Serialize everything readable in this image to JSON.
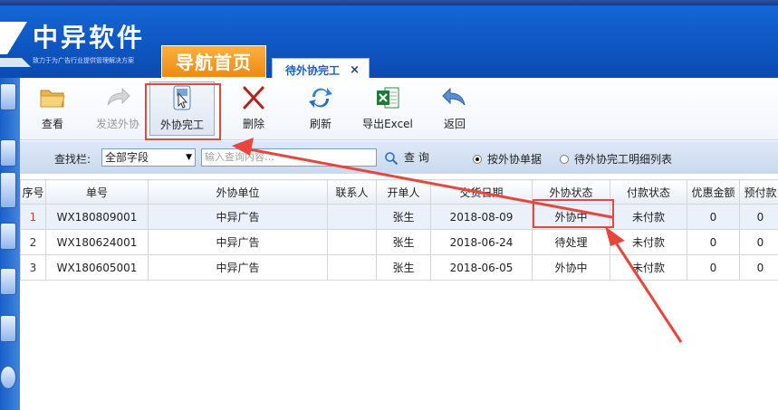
{
  "header": {
    "brand_title": "中异软件",
    "brand_slogan": "致力于为广告行业提供管理解决方案",
    "nav_home": "导航首页",
    "active_tab": "待外协完工",
    "tab_close": "×"
  },
  "toolbar": {
    "view": "查看",
    "send": "发送外协",
    "complete": "外协完工",
    "delete": "删除",
    "refresh": "刷新",
    "export": "导出Excel",
    "back": "返回"
  },
  "search": {
    "label": "查找栏:",
    "field": "全部字段",
    "placeholder": "输入查询内容…",
    "button": "查 询",
    "radio_single": "按外协单据",
    "radio_detail": "待外协完工明细列表",
    "selected_radio": "按外协单据"
  },
  "table": {
    "columns": [
      "序号",
      "单号",
      "外协单位",
      "联系人",
      "开单人",
      "交货日期",
      "外协状态",
      "付款状态",
      "优惠金额",
      "预付款"
    ],
    "rows": [
      {
        "seq": "1",
        "no": "WX180809001",
        "unit": "中异广告",
        "contact": "",
        "creator": "张生",
        "date": "2018-08-09",
        "status": "外协中",
        "pay": "未付款",
        "discount": "0",
        "prepay": "0"
      },
      {
        "seq": "2",
        "no": "WX180624001",
        "unit": "中异广告",
        "contact": "",
        "creator": "张生",
        "date": "2018-06-24",
        "status": "待处理",
        "pay": "未付款",
        "discount": "0",
        "prepay": "0"
      },
      {
        "seq": "3",
        "no": "WX180605001",
        "unit": "中异广告",
        "contact": "",
        "creator": "张生",
        "date": "2018-06-05",
        "status": "外协中",
        "pay": "未付款",
        "discount": "0",
        "prepay": "0"
      }
    ]
  },
  "colors": {
    "header_blue": "#1467d6",
    "nav_orange": "#f39a1e",
    "annotation_red": "#e8463d"
  }
}
